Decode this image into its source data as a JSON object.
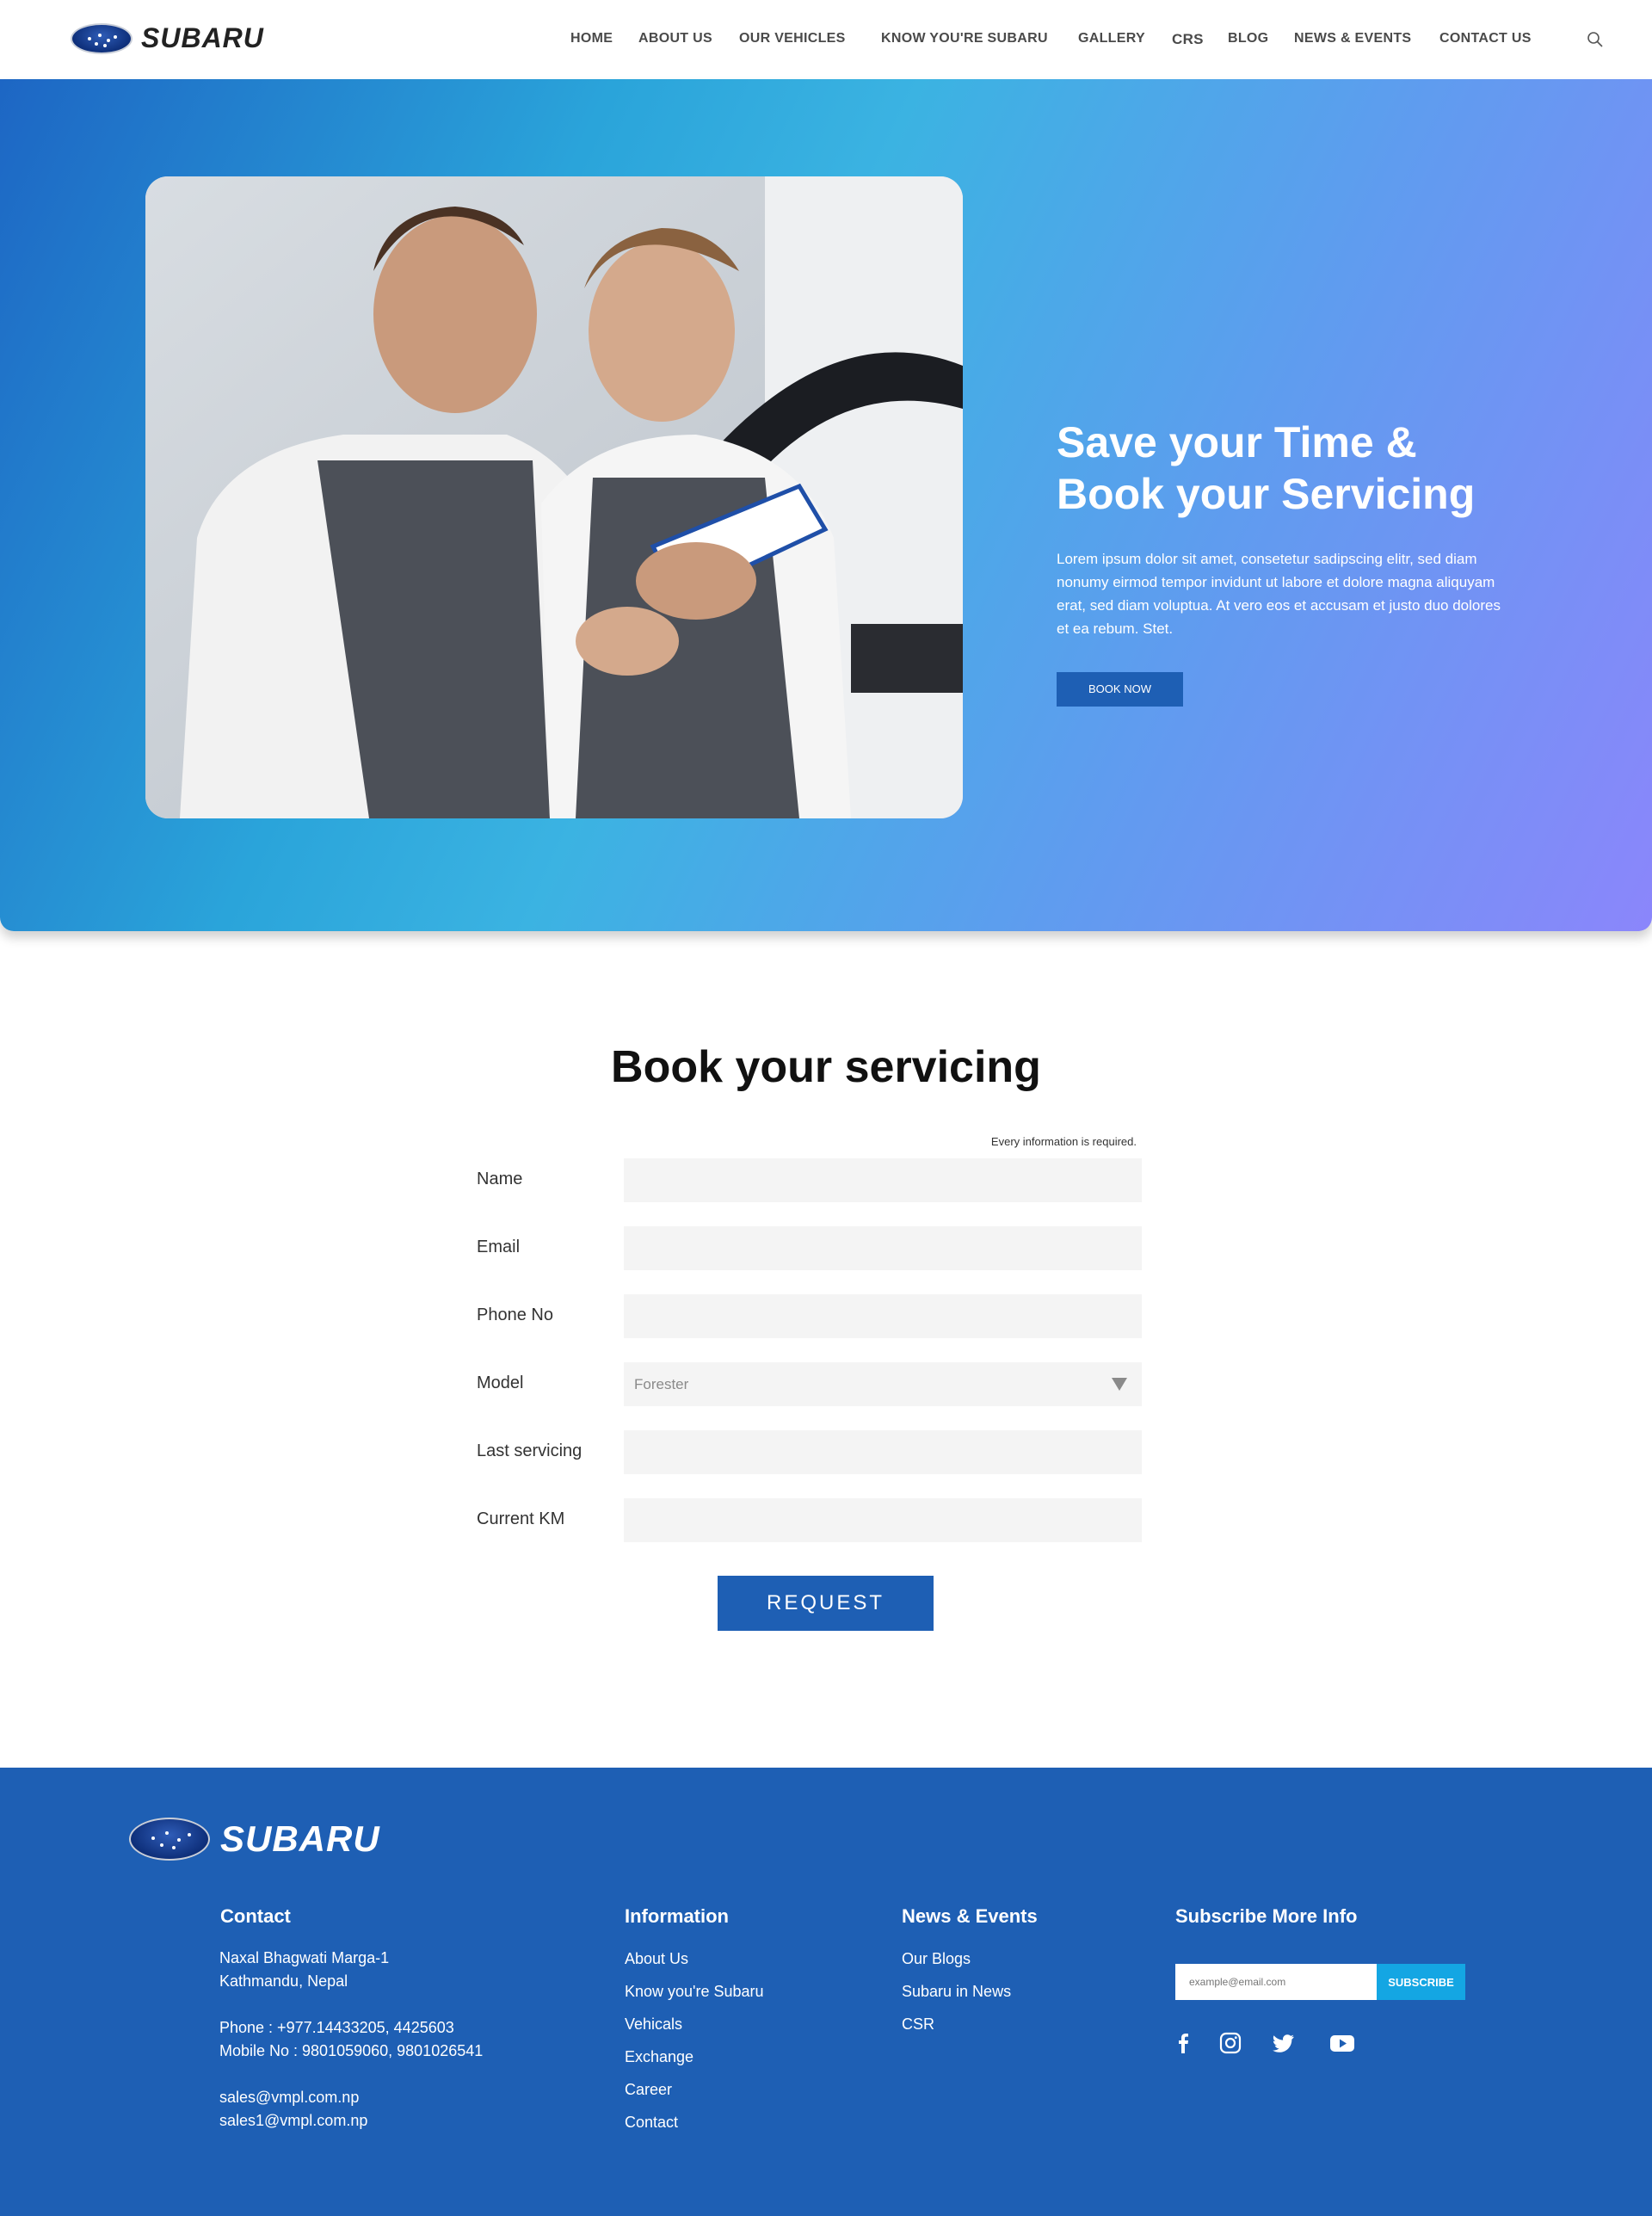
{
  "brand": {
    "name": "SUBARU"
  },
  "nav": {
    "items": [
      {
        "label": "HOME"
      },
      {
        "label": "ABOUT US"
      },
      {
        "label": "OUR VEHICLES"
      },
      {
        "label": "KNOW YOU'RE SUBARU"
      },
      {
        "label": "GALLERY"
      },
      {
        "label": "CRS"
      },
      {
        "label": "BLOG"
      },
      {
        "label": "NEWS & EVENTS"
      },
      {
        "label": "CONTACT US"
      }
    ],
    "search_icon": "search-icon"
  },
  "hero": {
    "title_line1": "Save your Time &",
    "title_line2": "Book your Servicing",
    "text": "Lorem ipsum dolor sit amet, consetetur sadipscing elitr, sed diam nonumy eirmod tempor invidunt ut labore et dolore magna aliquyam erat, sed diam voluptua. At vero eos et accusam et justo duo dolores et ea rebum. Stet.",
    "button": "BOOK NOW"
  },
  "form": {
    "title": "Book your servicing",
    "required_note": "Every information is required.",
    "fields": [
      {
        "label": "Name",
        "value": ""
      },
      {
        "label": "Email",
        "value": ""
      },
      {
        "label": "Phone No",
        "value": ""
      },
      {
        "label": "Model",
        "value": "Forester"
      },
      {
        "label": "Last servicing",
        "value": ""
      },
      {
        "label": "Current KM",
        "value": ""
      }
    ],
    "submit": "REQUEST"
  },
  "footer": {
    "contact": {
      "heading": "Contact",
      "address1": "Naxal Bhagwati Marga-1",
      "address2": "Kathmandu, Nepal",
      "phone": "Phone : +977.14433205, 4425603",
      "mobile": "Mobile No : 9801059060, 9801026541",
      "email1": "sales@vmpl.com.np",
      "email2": "sales1@vmpl.com.np"
    },
    "information": {
      "heading": "Information",
      "links": [
        "About Us",
        "Know you're Subaru",
        "Vehicals",
        "Exchange",
        "Career",
        "Contact"
      ]
    },
    "news": {
      "heading": "News & Events",
      "links": [
        "Our Blogs",
        "Subaru in News",
        "CSR"
      ]
    },
    "subscribe": {
      "heading": "Subscribe More Info",
      "placeholder": "example@email.com",
      "button": "SUBSCRIBE",
      "social_icons": [
        "facebook-icon",
        "instagram-icon",
        "twitter-icon",
        "youtube-icon"
      ]
    }
  },
  "colors": {
    "primary": "#1e5fb4",
    "accent": "#14a6e3",
    "hero_gradient_start": "#1d66c4",
    "hero_gradient_end": "#8b86fb"
  }
}
